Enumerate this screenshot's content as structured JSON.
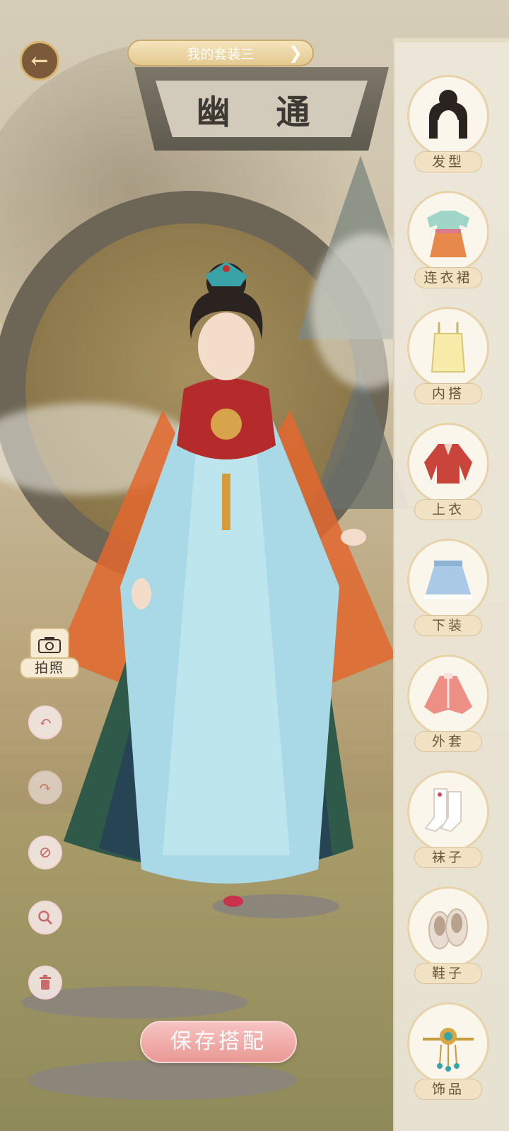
{
  "header": {
    "outfit_title": "我的套装三",
    "next_icon": "chevron-right-icon",
    "back_icon": "back-arrow-icon",
    "plaque_text": "幽 通"
  },
  "categories": [
    {
      "label": "发型",
      "icon": "hairstyle-icon"
    },
    {
      "label": "连衣裙",
      "icon": "dress-icon"
    },
    {
      "label": "内搭",
      "icon": "innerwear-icon"
    },
    {
      "label": "上衣",
      "icon": "top-icon"
    },
    {
      "label": "下装",
      "icon": "skirt-icon"
    },
    {
      "label": "外套",
      "icon": "coat-icon"
    },
    {
      "label": "袜子",
      "icon": "socks-icon"
    },
    {
      "label": "鞋子",
      "icon": "shoes-icon"
    },
    {
      "label": "饰品",
      "icon": "accessory-icon"
    }
  ],
  "tools": {
    "photo_label": "拍照",
    "undo_icon": "undo-icon",
    "redo_icon": "redo-icon",
    "clear_icon": "forbid-icon",
    "zoom_icon": "zoom-icon",
    "delete_icon": "trash-icon"
  },
  "save_label": "保存搭配",
  "colors": {
    "accent_gold": "#d9b36a",
    "save_pink": "#e99995",
    "panel_bg": "#eee8db"
  }
}
